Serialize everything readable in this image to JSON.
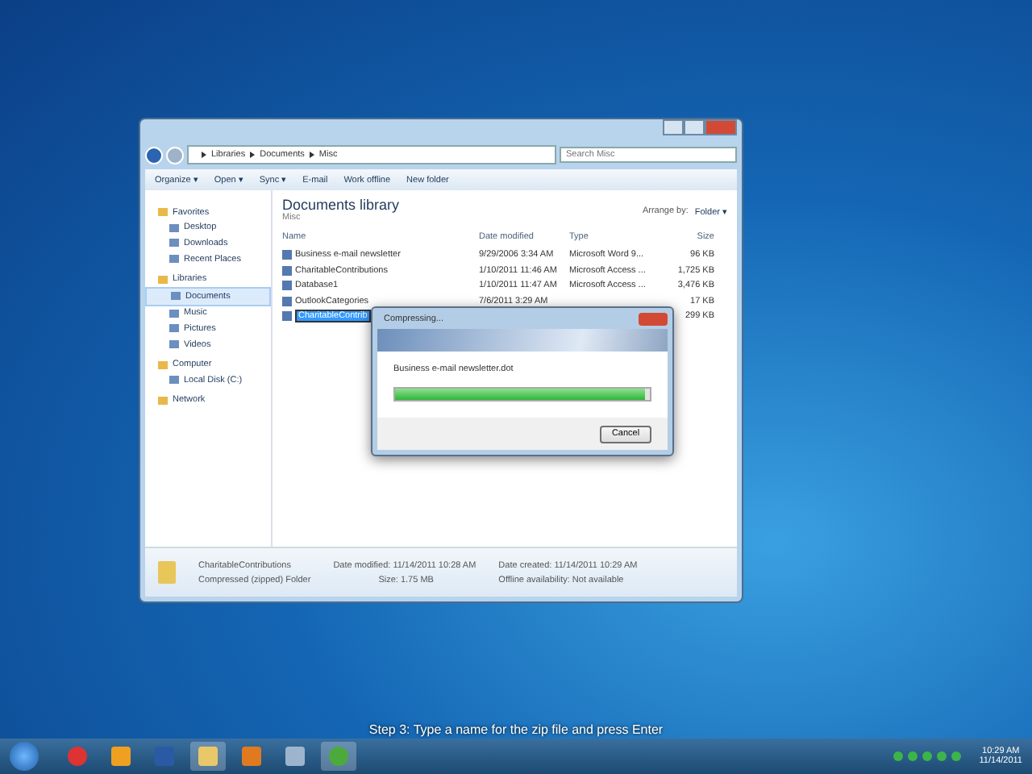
{
  "explorer": {
    "breadcrumb": [
      "Libraries",
      "Documents",
      "Misc"
    ],
    "search": {
      "placeholder": "Search Misc"
    },
    "toolbar": [
      "Organize ▾",
      "Open ▾",
      "Sync ▾",
      "E-mail",
      "Work offline",
      "New folder"
    ],
    "nav": [
      {
        "label": "Favorites",
        "kind": "header",
        "selected": false
      },
      {
        "label": "Desktop",
        "kind": "item",
        "selected": false
      },
      {
        "label": "Downloads",
        "kind": "item",
        "selected": false
      },
      {
        "label": "Recent Places",
        "kind": "item",
        "selected": false
      },
      {
        "label": "Libraries",
        "kind": "header",
        "selected": false
      },
      {
        "label": "Documents",
        "kind": "item",
        "selected": true
      },
      {
        "label": "Music",
        "kind": "item",
        "selected": false
      },
      {
        "label": "Pictures",
        "kind": "item",
        "selected": false
      },
      {
        "label": "Videos",
        "kind": "item",
        "selected": false
      },
      {
        "label": "Computer",
        "kind": "header",
        "selected": false
      },
      {
        "label": "Local Disk (C:)",
        "kind": "item",
        "selected": false
      },
      {
        "label": "Network",
        "kind": "header",
        "selected": false
      }
    ],
    "library_title": "Documents library",
    "library_sub": "Misc",
    "arrange_label": "Arrange by:",
    "arrange_value": "Folder ▾",
    "columns": [
      "Name",
      "Date modified",
      "Type",
      "Size"
    ],
    "rows": [
      {
        "name": "Business e-mail newsletter",
        "date": "9/29/2006 3:34 AM",
        "type": "Microsoft Word 9...",
        "size": "96 KB",
        "selected": false
      },
      {
        "name": "CharitableContributions",
        "date": "1/10/2011 11:46 AM",
        "type": "Microsoft Access ...",
        "size": "1,725 KB",
        "selected": false
      },
      {
        "name": "Database1",
        "date": "1/10/2011 11:47 AM",
        "type": "Microsoft Access ...",
        "size": "3,476 KB",
        "selected": false
      },
      {
        "name": "OutlookCategories",
        "date": "7/6/2011 3:29 AM",
        "type": "",
        "size": "17 KB",
        "selected": false
      },
      {
        "name": "CharitableContrib",
        "date": "",
        "type": "",
        "size": "299 KB",
        "selected": true
      }
    ],
    "details": {
      "name": "CharitableContributions",
      "kind": "Compressed (zipped) Folder",
      "modified": "Date modified: 11/14/2011 10:28 AM",
      "size": "Size: 1.75 MB",
      "created": "Date created: 11/14/2011 10:29 AM",
      "offline": "Offline availability: Not available"
    }
  },
  "dialog": {
    "title": "Compressing...",
    "file": "Business e-mail newsletter.dot",
    "level": 0.98,
    "cancel": "Cancel"
  },
  "caption": "Step 3: Type a name for the zip file and press Enter",
  "taskbar": {
    "time": "10:29 AM",
    "date": "11/14/2011"
  }
}
